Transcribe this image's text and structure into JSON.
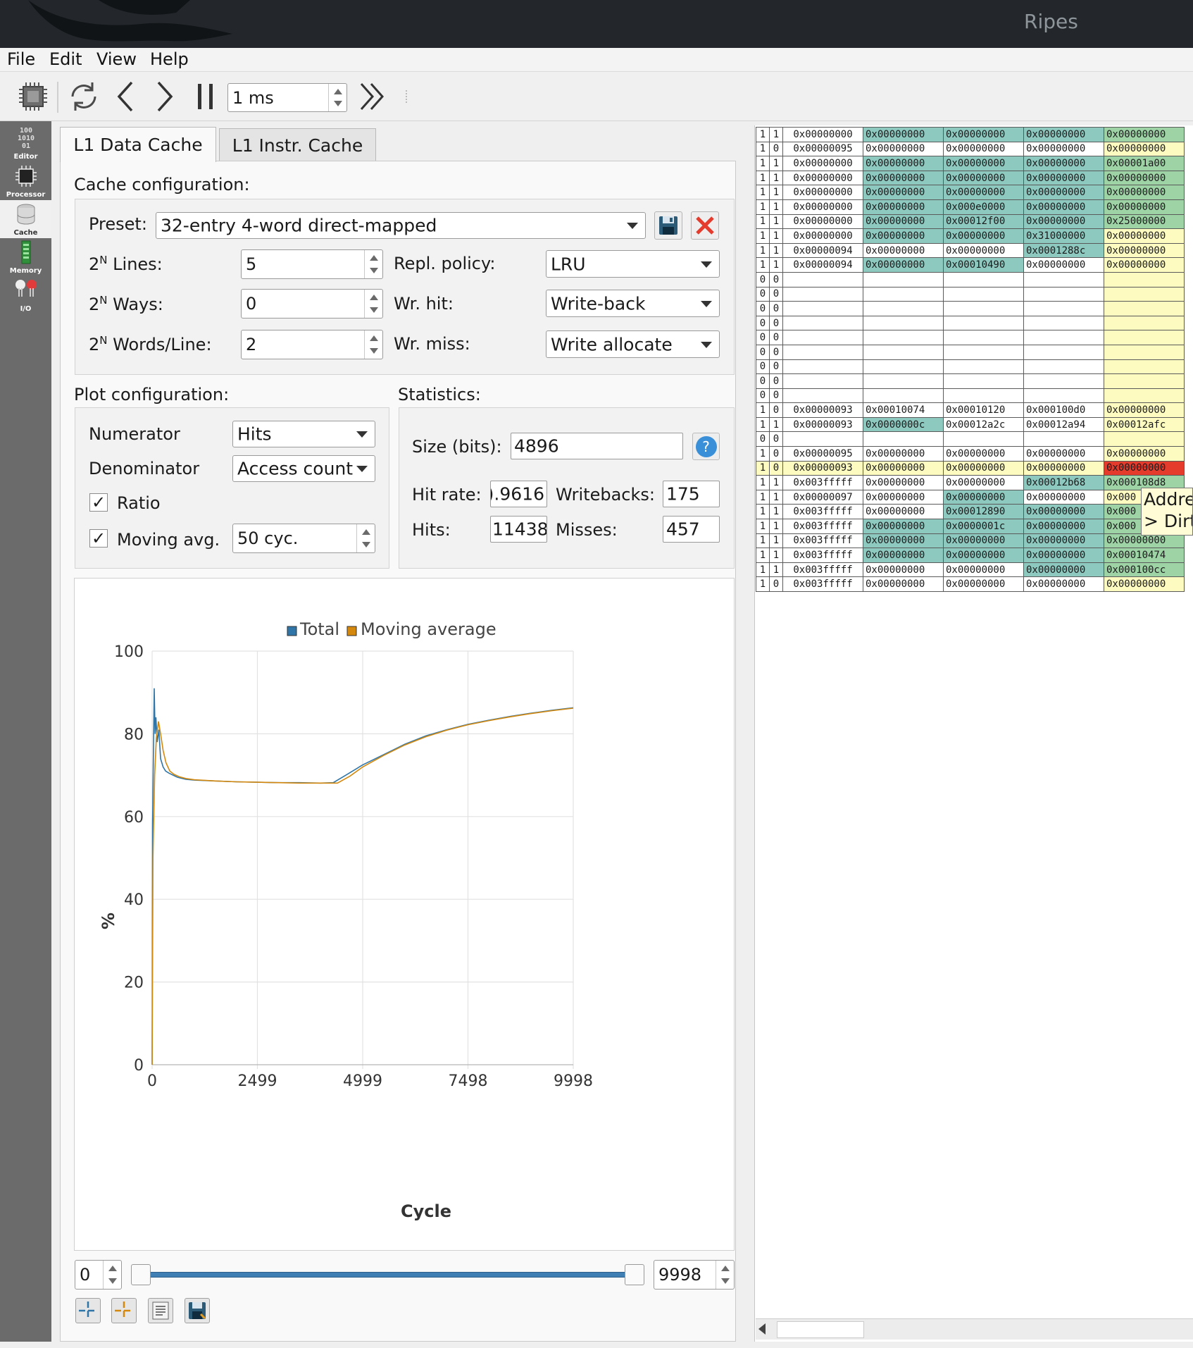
{
  "window": {
    "title": "Ripes"
  },
  "menu": [
    "File",
    "Edit",
    "View",
    "Help"
  ],
  "toolbar": {
    "delay": "1 ms"
  },
  "sidebar": [
    "Editor",
    "Processor",
    "Cache",
    "Memory",
    "I/O"
  ],
  "tabs": [
    "L1 Data Cache",
    "L1 Instr. Cache"
  ],
  "cache_config": {
    "heading": "Cache configuration:",
    "preset_label": "Preset:",
    "preset": "32-entry 4-word direct-mapped",
    "lines_label": "Lines:",
    "lines": "5",
    "ways_label": "Ways:",
    "ways": "0",
    "words_label": "Words/Line:",
    "words": "2",
    "exp_base": "2",
    "exp_sup": "N",
    "repl_label": "Repl. policy:",
    "repl": "LRU",
    "wrhit_label": "Wr. hit:",
    "wrhit": "Write-back",
    "wrmiss_label": "Wr. miss:",
    "wrmiss": "Write allocate"
  },
  "plot_config": {
    "heading": "Plot configuration:",
    "numerator_label": "Numerator",
    "numerator": "Hits",
    "denominator_label": "Denominator",
    "denominator": "Access count",
    "ratio_label": "Ratio",
    "ratio_checked": true,
    "movavg_label": "Moving avg.",
    "movavg_checked": true,
    "movavg": "50 cyc.",
    "check_mark": "✓"
  },
  "statistics": {
    "heading": "Statistics:",
    "size_label": "Size (bits):",
    "size": "4896",
    "hitrate_label": "Hit rate:",
    "hitrate": ").9616",
    "writebacks_label": "Writebacks:",
    "writebacks": "175",
    "hits_label": "Hits:",
    "hits": "11438",
    "misses_label": "Misses:",
    "misses": "457",
    "help_icon": "?"
  },
  "range": {
    "min": "0",
    "max": "9998"
  },
  "chart_data": {
    "type": "line",
    "xlabel": "Cycle",
    "ylabel": "%",
    "xlim": [
      0,
      9998
    ],
    "ylim": [
      0,
      100
    ],
    "xticks": [
      "0",
      "2499",
      "4999",
      "7498",
      "9998"
    ],
    "yticks": [
      "0",
      "20",
      "40",
      "60",
      "80",
      "100"
    ],
    "legend_position": "top",
    "grid": true,
    "series": [
      {
        "name": "Total",
        "color": "#2f75a8",
        "points": [
          [
            0,
            0
          ],
          [
            10,
            58
          ],
          [
            30,
            75
          ],
          [
            50,
            91
          ],
          [
            70,
            80
          ],
          [
            90,
            84
          ],
          [
            120,
            78
          ],
          [
            160,
            81
          ],
          [
            200,
            74
          ],
          [
            260,
            72
          ],
          [
            320,
            71
          ],
          [
            400,
            70.5
          ],
          [
            500,
            70
          ],
          [
            600,
            69.5
          ],
          [
            800,
            69
          ],
          [
            1000,
            68.8
          ],
          [
            1500,
            68.6
          ],
          [
            2000,
            68.4
          ],
          [
            2500,
            68.3
          ],
          [
            3000,
            68.2
          ],
          [
            3500,
            68.2
          ],
          [
            4000,
            68.1
          ],
          [
            4300,
            68.2
          ],
          [
            4600,
            70
          ],
          [
            5000,
            72.5
          ],
          [
            5500,
            75
          ],
          [
            6000,
            77.5
          ],
          [
            6500,
            79.5
          ],
          [
            7000,
            81
          ],
          [
            7500,
            82.3
          ],
          [
            8000,
            83.3
          ],
          [
            8500,
            84.2
          ],
          [
            9000,
            85
          ],
          [
            9500,
            85.7
          ],
          [
            9998,
            86.3
          ]
        ]
      },
      {
        "name": "Moving average",
        "color": "#d4890e",
        "points": [
          [
            0,
            0
          ],
          [
            20,
            50
          ],
          [
            60,
            70
          ],
          [
            100,
            79
          ],
          [
            150,
            83
          ],
          [
            200,
            80
          ],
          [
            260,
            76
          ],
          [
            330,
            73
          ],
          [
            420,
            71
          ],
          [
            520,
            70.2
          ],
          [
            650,
            69.6
          ],
          [
            800,
            69.2
          ],
          [
            1000,
            68.9
          ],
          [
            1500,
            68.6
          ],
          [
            2000,
            68.4
          ],
          [
            2500,
            68.3
          ],
          [
            3000,
            68.2
          ],
          [
            3500,
            68.1
          ],
          [
            4000,
            68.1
          ],
          [
            4400,
            68.1
          ],
          [
            4700,
            69.8
          ],
          [
            5000,
            72
          ],
          [
            5500,
            74.8
          ],
          [
            6000,
            77.3
          ],
          [
            6500,
            79.3
          ],
          [
            7000,
            80.9
          ],
          [
            7500,
            82.2
          ],
          [
            8000,
            83.2
          ],
          [
            8500,
            84.1
          ],
          [
            9000,
            84.9
          ],
          [
            9500,
            85.6
          ],
          [
            9998,
            86.2
          ]
        ]
      }
    ]
  },
  "colors": {
    "titlebar": "#23272b",
    "sidebar": "#6b6b6b",
    "teal": "#8ec9c0",
    "yellow": "#fdfbbf",
    "red": "#e53b2c",
    "total": "#2f75a8",
    "movavg": "#d4890e"
  },
  "icons": [
    "processor-icon",
    "reset-icon",
    "back-icon",
    "forward-icon",
    "pause-icon",
    "run-icon",
    "save-icon",
    "delete-icon",
    "help-icon",
    "crosshair-icon",
    "crosshair-orange-icon",
    "copy-data-icon",
    "save-plot-icon",
    "editor-icon",
    "cache-icon",
    "memory-icon",
    "io-icon"
  ],
  "cache_table": {
    "tooltip": [
      "Addre",
      "> Dirt"
    ],
    "rows": [
      {
        "v": "1",
        "d": "1",
        "tag": "0x00000000",
        "w": [
          "0x00000000",
          "0x00000000",
          "0x00000000",
          "0x00000000"
        ],
        "hl": [
          1,
          1,
          1,
          1
        ]
      },
      {
        "v": "1",
        "d": "0",
        "tag": "0x00000095",
        "w": [
          "0x00000000",
          "0x00000000",
          "0x00000000",
          "0x00000000"
        ],
        "hl": [
          0,
          0,
          0,
          0
        ]
      },
      {
        "v": "1",
        "d": "1",
        "tag": "0x00000000",
        "w": [
          "0x00000000",
          "0x00000000",
          "0x00000000",
          "0x00001a00"
        ],
        "hl": [
          1,
          1,
          1,
          1
        ]
      },
      {
        "v": "1",
        "d": "1",
        "tag": "0x00000000",
        "w": [
          "0x00000000",
          "0x00000000",
          "0x00000000",
          "0x00000000"
        ],
        "hl": [
          1,
          1,
          1,
          1
        ]
      },
      {
        "v": "1",
        "d": "1",
        "tag": "0x00000000",
        "w": [
          "0x00000000",
          "0x00000000",
          "0x00000000",
          "0x00000000"
        ],
        "hl": [
          1,
          1,
          1,
          1
        ]
      },
      {
        "v": "1",
        "d": "1",
        "tag": "0x00000000",
        "w": [
          "0x00000000",
          "0x000e0000",
          "0x00000000",
          "0x00000000"
        ],
        "hl": [
          1,
          1,
          1,
          1
        ]
      },
      {
        "v": "1",
        "d": "1",
        "tag": "0x00000000",
        "w": [
          "0x00000000",
          "0x00012f00",
          "0x00000000",
          "0x25000000"
        ],
        "hl": [
          1,
          1,
          1,
          1
        ]
      },
      {
        "v": "1",
        "d": "1",
        "tag": "0x00000000",
        "w": [
          "0x00000000",
          "0x00000000",
          "0x31000000",
          "0x00000000"
        ],
        "hl": [
          1,
          1,
          1,
          0
        ]
      },
      {
        "v": "1",
        "d": "1",
        "tag": "0x00000094",
        "w": [
          "0x00000000",
          "0x00000000",
          "0x0001288c",
          "0x00000000"
        ],
        "hl": [
          0,
          0,
          1,
          0
        ]
      },
      {
        "v": "1",
        "d": "1",
        "tag": "0x00000094",
        "w": [
          "0x00000000",
          "0x00010490",
          "0x00000000",
          "0x00000000"
        ],
        "hl": [
          1,
          1,
          0,
          0
        ]
      },
      {
        "v": "0",
        "d": "0",
        "tag": "",
        "w": [
          "",
          "",
          "",
          ""
        ],
        "hl": [
          0,
          0,
          0,
          0
        ]
      },
      {
        "v": "0",
        "d": "0",
        "tag": "",
        "w": [
          "",
          "",
          "",
          ""
        ],
        "hl": [
          0,
          0,
          0,
          0
        ]
      },
      {
        "v": "0",
        "d": "0",
        "tag": "",
        "w": [
          "",
          "",
          "",
          ""
        ],
        "hl": [
          0,
          0,
          0,
          0
        ]
      },
      {
        "v": "0",
        "d": "0",
        "tag": "",
        "w": [
          "",
          "",
          "",
          ""
        ],
        "hl": [
          0,
          0,
          0,
          0
        ]
      },
      {
        "v": "0",
        "d": "0",
        "tag": "",
        "w": [
          "",
          "",
          "",
          ""
        ],
        "hl": [
          0,
          0,
          0,
          0
        ]
      },
      {
        "v": "0",
        "d": "0",
        "tag": "",
        "w": [
          "",
          "",
          "",
          ""
        ],
        "hl": [
          0,
          0,
          0,
          0
        ]
      },
      {
        "v": "0",
        "d": "0",
        "tag": "",
        "w": [
          "",
          "",
          "",
          ""
        ],
        "hl": [
          0,
          0,
          0,
          0
        ]
      },
      {
        "v": "0",
        "d": "0",
        "tag": "",
        "w": [
          "",
          "",
          "",
          ""
        ],
        "hl": [
          0,
          0,
          0,
          0
        ]
      },
      {
        "v": "0",
        "d": "0",
        "tag": "",
        "w": [
          "",
          "",
          "",
          ""
        ],
        "hl": [
          0,
          0,
          0,
          0
        ]
      },
      {
        "v": "1",
        "d": "0",
        "tag": "0x00000093",
        "w": [
          "0x00010074",
          "0x00010120",
          "0x000100d0",
          "0x00000000"
        ],
        "hl": [
          0,
          0,
          0,
          0
        ]
      },
      {
        "v": "1",
        "d": "1",
        "tag": "0x00000093",
        "w": [
          "0x0000000c",
          "0x00012a2c",
          "0x00012a94",
          "0x00012afc"
        ],
        "hl": [
          1,
          0,
          0,
          0
        ]
      },
      {
        "v": "0",
        "d": "0",
        "tag": "",
        "w": [
          "",
          "",
          "",
          ""
        ],
        "hl": [
          0,
          0,
          0,
          0
        ]
      },
      {
        "v": "1",
        "d": "0",
        "tag": "0x00000095",
        "w": [
          "0x00000000",
          "0x00000000",
          "0x00000000",
          "0x00000000"
        ],
        "hl": [
          0,
          0,
          0,
          0
        ]
      },
      {
        "v": "1",
        "d": "0",
        "tag": "0x00000093",
        "w": [
          "0x00000000",
          "0x00000000",
          "0x00000000",
          "0x00000000"
        ],
        "hl": [
          0,
          0,
          0,
          0
        ],
        "sel": true
      },
      {
        "v": "1",
        "d": "1",
        "tag": "0x003fffff",
        "w": [
          "0x00000000",
          "0x00000000",
          "0x00012b68",
          "0x000108d8"
        ],
        "hl": [
          0,
          0,
          1,
          1
        ]
      },
      {
        "v": "1",
        "d": "1",
        "tag": "0x00000097",
        "w": [
          "0x00000000",
          "0x00000000",
          "0x00000000",
          "0x000"
        ],
        "hl": [
          0,
          1,
          0,
          0
        ]
      },
      {
        "v": "1",
        "d": "1",
        "tag": "0x003fffff",
        "w": [
          "0x00000000",
          "0x00012890",
          "0x00000000",
          "0x000"
        ],
        "hl": [
          0,
          1,
          1,
          1
        ]
      },
      {
        "v": "1",
        "d": "1",
        "tag": "0x003fffff",
        "w": [
          "0x00000000",
          "0x0000001c",
          "0x00000000",
          "0x000"
        ],
        "hl": [
          1,
          1,
          1,
          1
        ]
      },
      {
        "v": "1",
        "d": "1",
        "tag": "0x003fffff",
        "w": [
          "0x00000000",
          "0x00000000",
          "0x00000000",
          "0x00000000"
        ],
        "hl": [
          1,
          1,
          1,
          1
        ]
      },
      {
        "v": "1",
        "d": "1",
        "tag": "0x003fffff",
        "w": [
          "0x00000000",
          "0x00000000",
          "0x00000000",
          "0x00010474"
        ],
        "hl": [
          1,
          1,
          1,
          1
        ]
      },
      {
        "v": "1",
        "d": "1",
        "tag": "0x003fffff",
        "w": [
          "0x00000000",
          "0x00000000",
          "0x00000000",
          "0x000100cc"
        ],
        "hl": [
          0,
          0,
          1,
          1
        ]
      },
      {
        "v": "1",
        "d": "0",
        "tag": "0x003fffff",
        "w": [
          "0x00000000",
          "0x00000000",
          "0x00000000",
          "0x00000000"
        ],
        "hl": [
          0,
          0,
          0,
          0
        ]
      }
    ]
  }
}
